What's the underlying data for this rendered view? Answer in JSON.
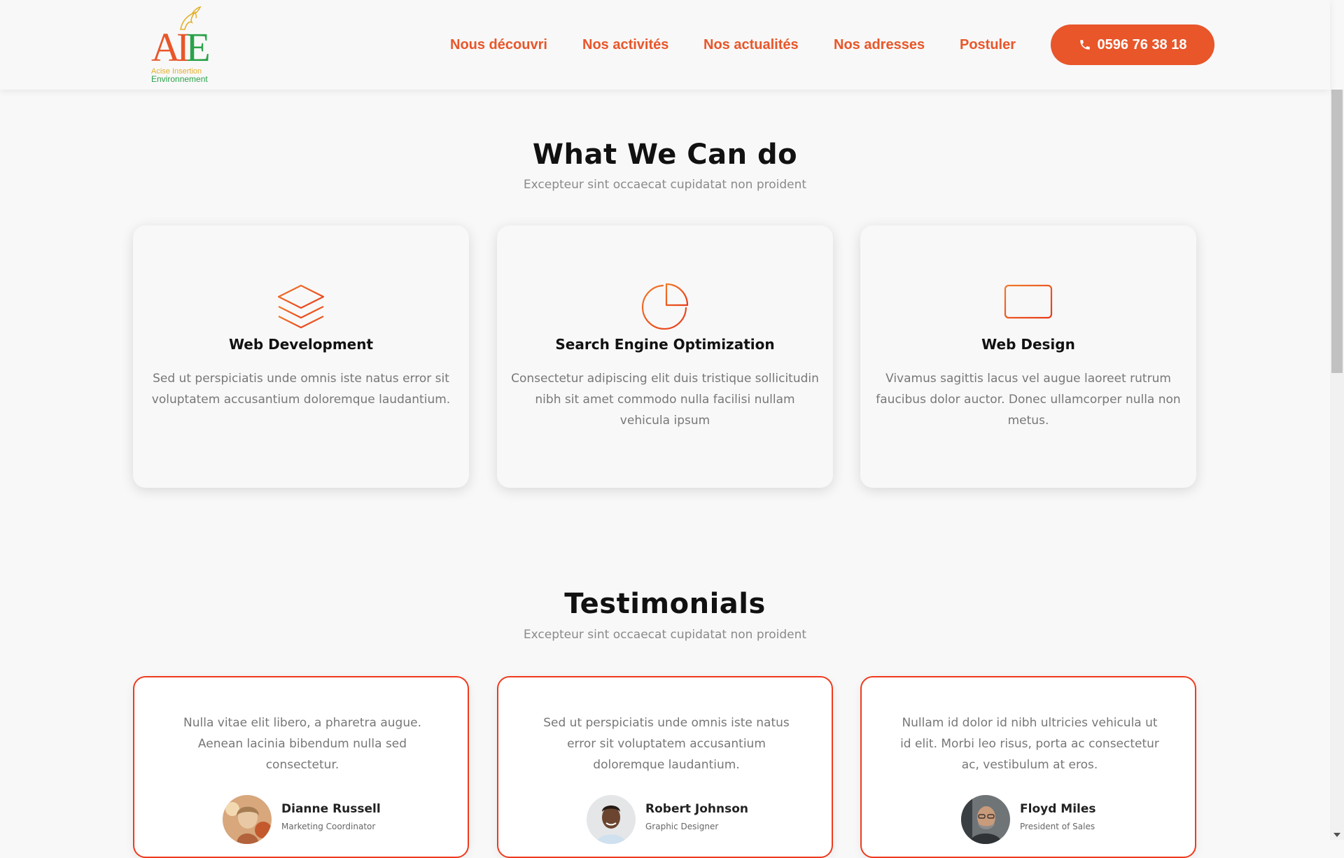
{
  "header": {
    "logo": {
      "letters": [
        "A",
        "I",
        "E"
      ],
      "line1": "Acise Insertion",
      "line2": "Environnement"
    },
    "nav": [
      {
        "label": "Nous découvri"
      },
      {
        "label": "Nos activités"
      },
      {
        "label": "Nos actualités"
      },
      {
        "label": "Nos adresses"
      },
      {
        "label": "Postuler"
      }
    ],
    "phone": {
      "label": "0596 76 38 18",
      "icon": "phone-icon"
    }
  },
  "services": {
    "title": "What We Can do",
    "subtitle": "Excepteur sint occaecat cupidatat non proident",
    "cards": [
      {
        "icon": "layers-icon",
        "title": "Web Development",
        "text": "Sed ut perspiciatis unde omnis iste natus error sit voluptatem accusantium doloremque laudantium."
      },
      {
        "icon": "pie-chart-icon",
        "title": "Search Engine Optimization",
        "text": "Consectetur adipiscing elit duis tristique sollicitudin nibh sit amet commodo nulla facilisi nullam vehicula ipsum"
      },
      {
        "icon": "monitor-icon",
        "title": "Web Design",
        "text": "Vivamus sagittis lacus vel augue laoreet rutrum faucibus dolor auctor. Donec ullamcorper nulla non metus."
      }
    ]
  },
  "testimonials": {
    "title": "Testimonials",
    "subtitle": "Excepteur sint occaecat cupidatat non proident",
    "cards": [
      {
        "quote": "Nulla vitae elit libero, a pharetra augue. Aenean lacinia bibendum nulla sed consectetur.",
        "name": "Dianne Russell",
        "role": "Marketing Coordinator"
      },
      {
        "quote": "Sed ut perspiciatis unde omnis iste natus error sit voluptatem accusantium doloremque laudantium.",
        "name": "Robert Johnson",
        "role": "Graphic Designer"
      },
      {
        "quote": "Nullam id dolor id nibh ultricies vehicula ut id elit. Morbi leo risus, porta ac consectetur ac, vestibulum at eros.",
        "name": "Floyd Miles",
        "role": "President of Sales"
      }
    ]
  },
  "colors": {
    "accent": "#e8562a",
    "card_border": "#ee3a1e",
    "logo_green": "#2aa24a",
    "logo_yellow": "#e2b02a"
  }
}
